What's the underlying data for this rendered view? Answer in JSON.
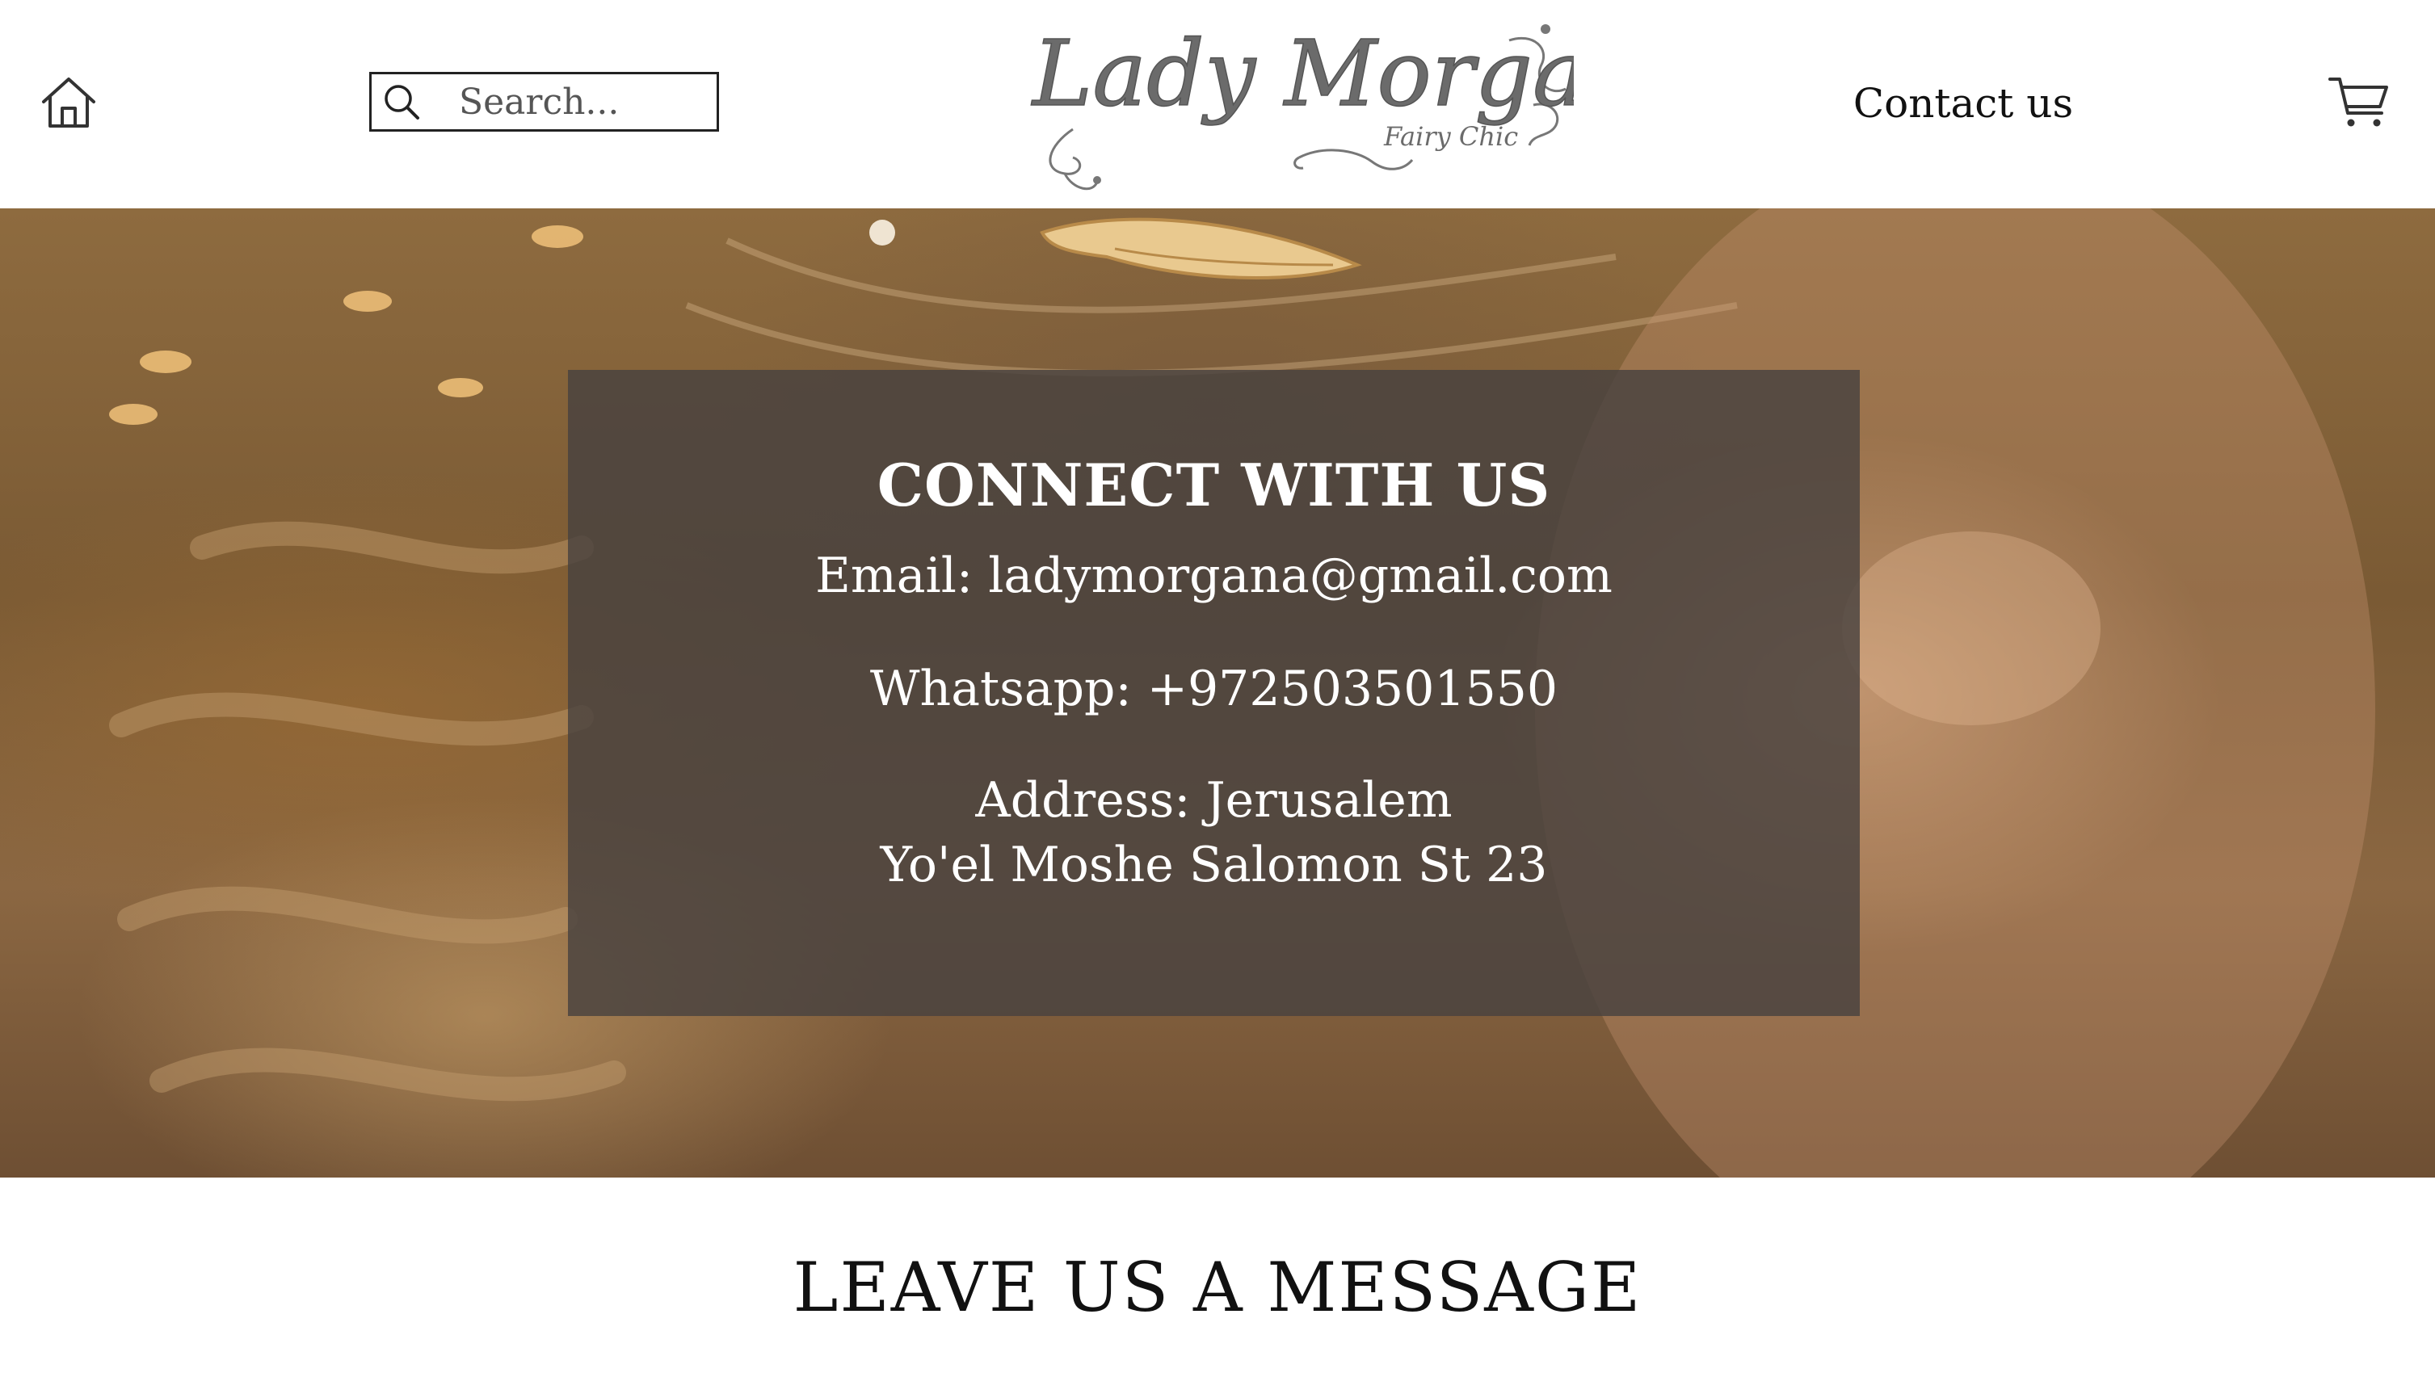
{
  "header": {
    "search": {
      "placeholder": "Search..."
    },
    "logo": {
      "name": "Lady Morgana",
      "tagline": "Fairy Chic"
    },
    "contact_label": "Contact us"
  },
  "hero": {
    "panel": {
      "title": "CONNECT WITH US",
      "email": "Email: ladymorgana@gmail.com",
      "whatsapp": "Whatsapp: +972503501550",
      "address_line1": "Address: Jerusalem",
      "address_line2": "Yo'el Moshe Salomon St 23"
    }
  },
  "message_section": {
    "title": "LEAVE US A MESSAGE"
  },
  "icons": {
    "home": "home-icon",
    "search": "search-icon",
    "cart": "cart-icon"
  },
  "colors": {
    "panel_bg": "#48423f",
    "text_dark": "#111111",
    "logo_grey": "#6b6b6b"
  }
}
